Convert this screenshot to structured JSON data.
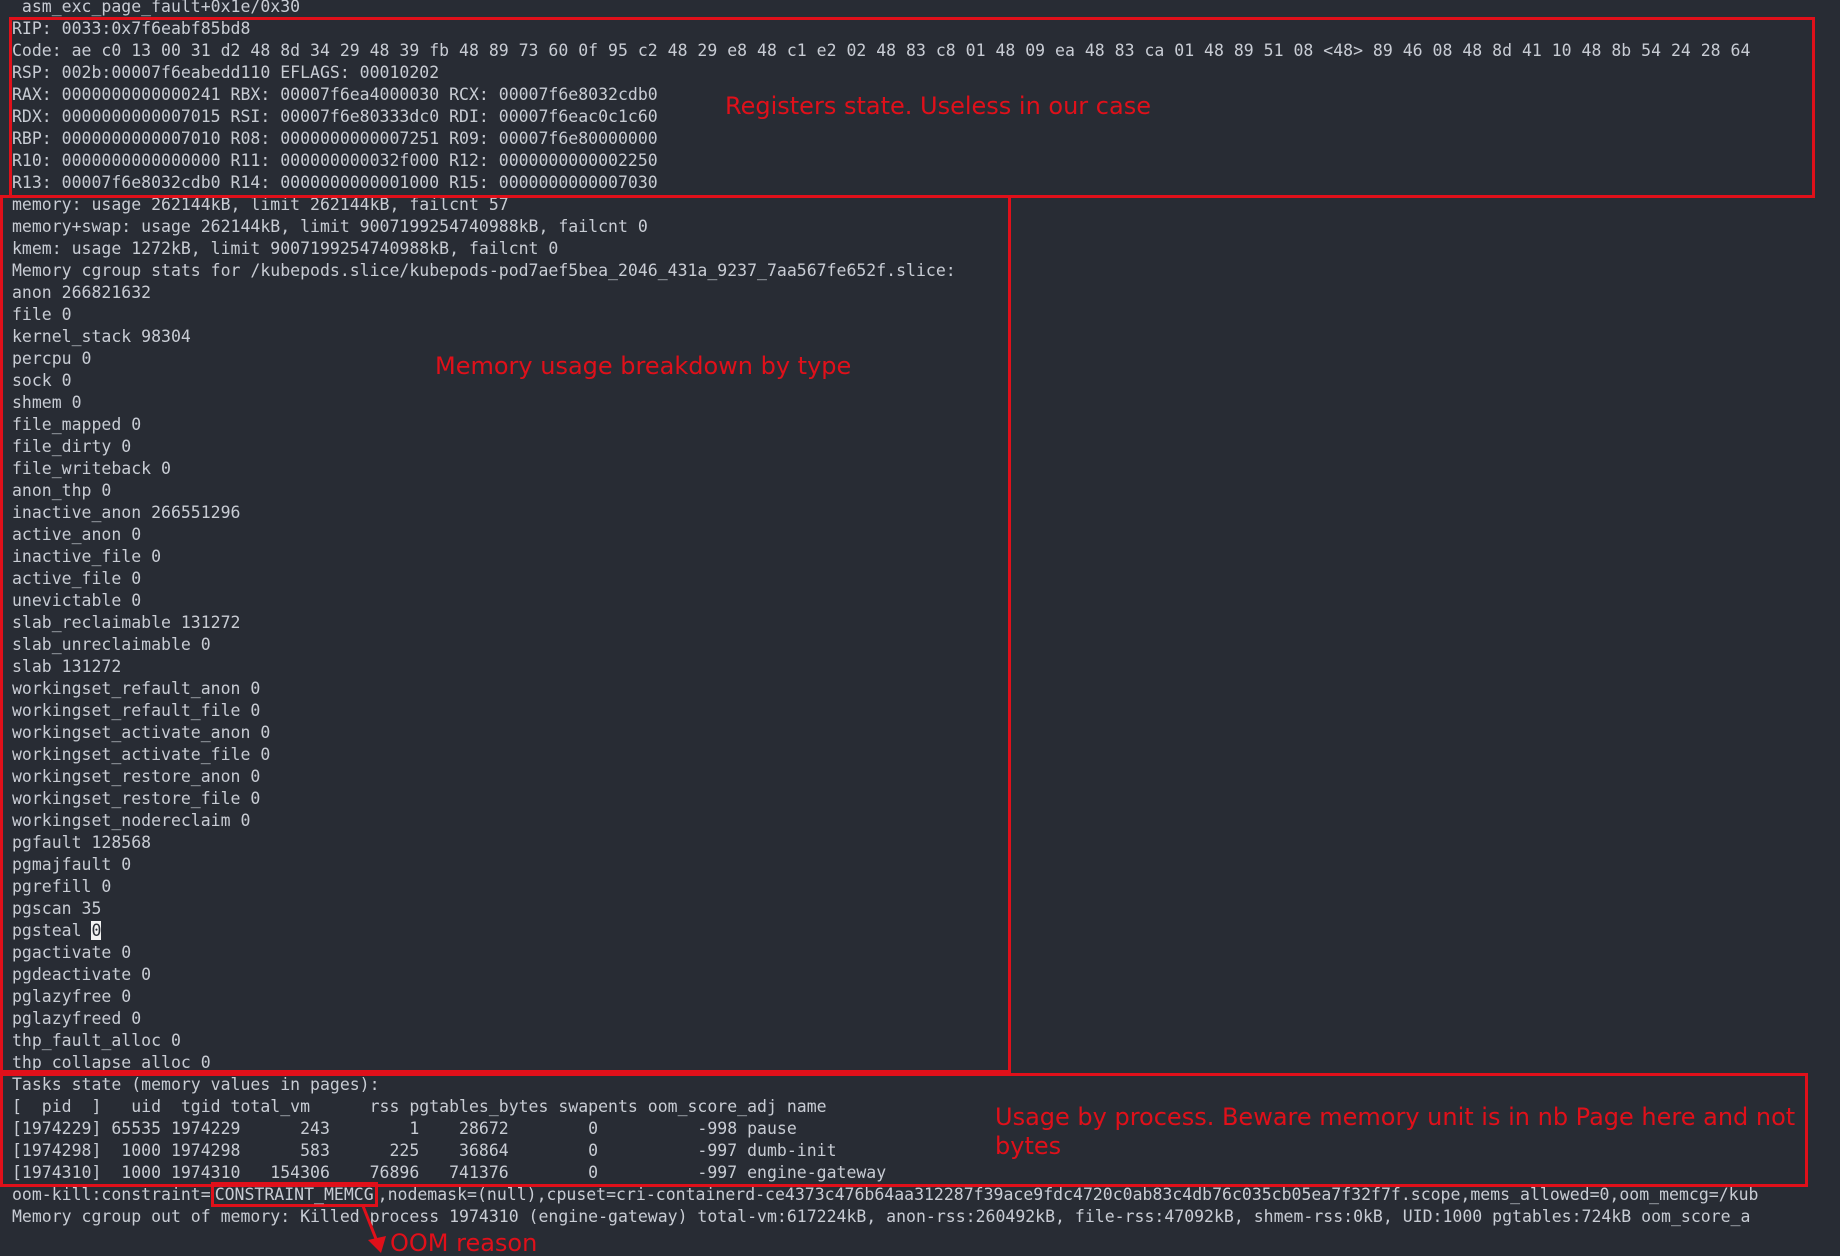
{
  "terminal": {
    "lines": [
      " asm_exc_page_fault+0x1e/0x30",
      "RIP: 0033:0x7f6eabf85bd8",
      "Code: ae c0 13 00 31 d2 48 8d 34 29 48 39 fb 48 89 73 60 0f 95 c2 48 29 e8 48 c1 e2 02 48 83 c8 01 48 09 ea 48 83 ca 01 48 89 51 08 <48> 89 46 08 48 8d 41 10 48 8b 54 24 28 64",
      "RSP: 002b:00007f6eabedd110 EFLAGS: 00010202",
      "RAX: 0000000000000241 RBX: 00007f6ea4000030 RCX: 00007f6e8032cdb0",
      "RDX: 0000000000007015 RSI: 00007f6e80333dc0 RDI: 00007f6eac0c1c60",
      "RBP: 0000000000007010 R08: 0000000000007251 R09: 00007f6e80000000",
      "R10: 0000000000000000 R11: 000000000032f000 R12: 0000000000002250",
      "R13: 00007f6e8032cdb0 R14: 0000000000001000 R15: 0000000000007030",
      "memory: usage 262144kB, limit 262144kB, failcnt 57",
      "memory+swap: usage 262144kB, limit 9007199254740988kB, failcnt 0",
      "kmem: usage 1272kB, limit 9007199254740988kB, failcnt 0",
      "Memory cgroup stats for /kubepods.slice/kubepods-pod7aef5bea_2046_431a_9237_7aa567fe652f.slice:",
      "anon 266821632",
      "file 0",
      "kernel_stack 98304",
      "percpu 0",
      "sock 0",
      "shmem 0",
      "file_mapped 0",
      "file_dirty 0",
      "file_writeback 0",
      "anon_thp 0",
      "inactive_anon 266551296",
      "active_anon 0",
      "inactive_file 0",
      "active_file 0",
      "unevictable 0",
      "slab_reclaimable 131272",
      "slab_unreclaimable 0",
      "slab 131272",
      "workingset_refault_anon 0",
      "workingset_refault_file 0",
      "workingset_activate_anon 0",
      "workingset_activate_file 0",
      "workingset_restore_anon 0",
      "workingset_restore_file 0",
      "workingset_nodereclaim 0",
      "pgfault 128568",
      "pgmajfault 0",
      "pgrefill 0",
      "pgscan 35",
      "pgsteal ",
      "pgactivate 0",
      "pgdeactivate 0",
      "pglazyfree 0",
      "pglazyfreed 0",
      "thp_fault_alloc 0",
      "thp_collapse_alloc 0",
      "Tasks state (memory values in pages):",
      "[  pid  ]   uid  tgid total_vm      rss pgtables_bytes swapents oom_score_adj name",
      "[1974229] 65535 1974229      243        1    28672        0          -998 pause",
      "[1974298]  1000 1974298      583      225    36864        0          -997 dumb-init",
      "[1974310]  1000 1974310   154306    76896   741376        0          -997 engine-gateway",
      "oom-kill:constraint=",
      "Memory cgroup out of memory: Killed process 1974310 (engine-gateway) total-vm:617224kB, anon-rss:260492kB, file-rss:47092kB, shmem-rss:0kB, UID:1000 pgtables:724kB oom_score_a"
    ],
    "pgsteal_cursor_value": "0",
    "oom_constraint_value": "CONSTRAINT_MEMCG",
    "oom_kill_tail": ",nodemask=(null),cpuset=cri-containerd-ce4373c476b64aa312287f39ace9fdc4720c0ab83c4db76c035cb05ea7f32f7f.scope,mems_allowed=0,oom_memcg=/kub"
  },
  "annotations": {
    "registers": "Registers state. Useless in our case",
    "memory_breakdown": "Memory usage breakdown by type",
    "usage_by_process": "Usage by process. Beware memory unit is in nb Page here and not bytes",
    "oom_reason": "OOM reason"
  },
  "colors": {
    "background": "#282c34",
    "text": "#c8ccd4",
    "annotation": "#e0101a",
    "cursor": "#f2f2f2"
  }
}
